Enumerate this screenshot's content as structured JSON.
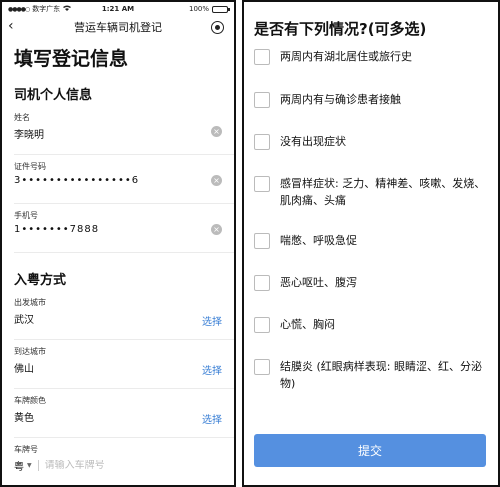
{
  "status_bar": {
    "carrier": "数字广东",
    "wifi_icon": "wifi-icon",
    "time": "1:21 AM",
    "battery_percent": "100%",
    "battery_level": 1.0
  },
  "nav": {
    "back_icon": "chevron-left-icon",
    "title": "营运车辆司机登记",
    "capsule_icon": "record-icon"
  },
  "page_title": "填写登记信息",
  "personal_section": {
    "title": "司机个人信息",
    "fields": [
      {
        "label": "姓名",
        "value": "李晓明"
      },
      {
        "label": "证件号码",
        "value": "3••••••••••••••••6"
      },
      {
        "label": "手机号",
        "value": "1•••••••7888"
      }
    ]
  },
  "travel_section": {
    "title": "入粤方式",
    "fields": [
      {
        "label": "出发城市",
        "value": "武汉",
        "action": "选择"
      },
      {
        "label": "到达城市",
        "value": "佛山",
        "action": "选择"
      },
      {
        "label": "车牌颜色",
        "value": "黄色",
        "action": "选择"
      }
    ],
    "plate": {
      "label": "车牌号",
      "province": "粤",
      "placeholder": "请输入车牌号"
    }
  },
  "question": {
    "title": "是否有下列情况?(可多选)",
    "options": [
      "两周内有湖北居住或旅行史",
      "两周内有与确诊患者接触",
      "没有出现症状",
      "感冒样症状: 乏力、精神差、咳嗽、发烧、肌肉痛、头痛",
      "喘憋、呼吸急促",
      "恶心呕吐、腹泻",
      "心慌、胸闷",
      "结膜炎 (红眼病样表现: 眼睛涩、红、分泌物)"
    ],
    "submit_label": "提交"
  },
  "colors": {
    "accent": "#3a7fd5",
    "submit_bg": "#5590e0"
  }
}
